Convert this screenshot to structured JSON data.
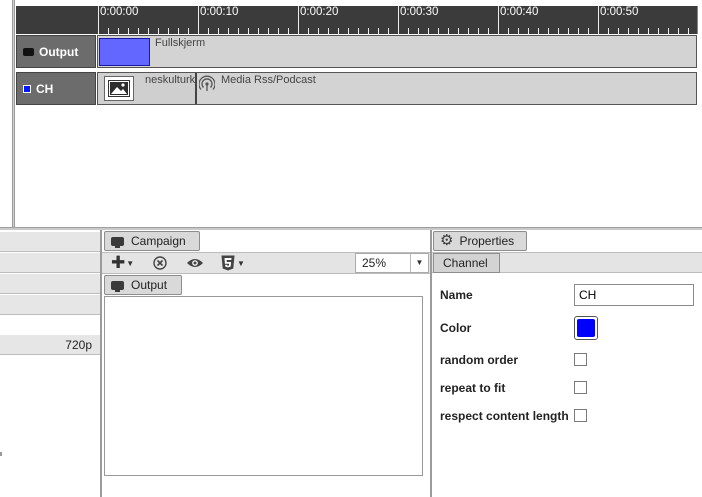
{
  "timeline": {
    "ruler_ticks": [
      "0:00:00",
      "0:00:10",
      "0:00:20",
      "0:00:30",
      "0:00:40",
      "0:00:50"
    ],
    "tracks": [
      {
        "label": "Output",
        "icon": "monitor-icon",
        "clips": [
          {
            "label": "Fullskjerm",
            "color": "#6367ff"
          }
        ]
      },
      {
        "label": "CH",
        "icon": "channel-color-icon",
        "icon_color": "#0018ff",
        "clips": [
          {
            "label": "neskulturkalender",
            "icon": "image-icon"
          },
          {
            "label": "Media Rss/Podcast",
            "icon": "rss-icon"
          }
        ]
      }
    ]
  },
  "left_panel": {
    "rows": [
      "",
      "",
      "",
      "",
      "720p"
    ]
  },
  "campaign": {
    "tab_label": "Campaign",
    "toolbar": {
      "add_icon": "plus-icon",
      "remove_icon": "remove-circle-icon",
      "preview_icon": "eye-icon",
      "html5_icon": "html5-icon",
      "zoom": "25%"
    },
    "output_tab_label": "Output"
  },
  "properties": {
    "tab_label": "Properties",
    "section_tab": "Channel",
    "name_label": "Name",
    "name_value": "CH",
    "color_label": "Color",
    "color_value": "#0000ff",
    "random_order_label": "random order",
    "repeat_to_fit_label": "repeat to fit",
    "respect_content_length_label": "respect content length"
  }
}
